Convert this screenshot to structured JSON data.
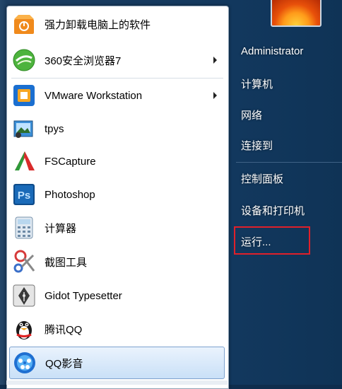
{
  "user": {
    "name": "Administrator"
  },
  "programs": [
    {
      "label": "强力卸载电脑上的软件",
      "icon": "uninstall-box-icon",
      "arrow": false
    },
    {
      "label": "360安全浏览器7",
      "icon": "360-browser-icon",
      "arrow": true
    },
    {
      "label": "VMware Workstation",
      "icon": "vmware-icon",
      "arrow": true
    },
    {
      "label": "tpys",
      "icon": "image-compress-icon",
      "arrow": false
    },
    {
      "label": "FSCapture",
      "icon": "fscapture-icon",
      "arrow": false
    },
    {
      "label": "Photoshop",
      "icon": "photoshop-icon",
      "arrow": false
    },
    {
      "label": "计算器",
      "icon": "calculator-icon",
      "arrow": false
    },
    {
      "label": "截图工具",
      "icon": "snipping-tool-icon",
      "arrow": false
    },
    {
      "label": "Gidot Typesetter",
      "icon": "fountain-pen-icon",
      "arrow": false
    },
    {
      "label": "腾讯QQ",
      "icon": "qq-penguin-icon",
      "arrow": false
    },
    {
      "label": "QQ影音",
      "icon": "qq-player-icon",
      "arrow": false,
      "selected": true
    }
  ],
  "right_items": [
    {
      "label": "Administrator"
    },
    {
      "label": "计算机"
    },
    {
      "label": "网络"
    },
    {
      "label": "连接到"
    },
    {
      "label": "控制面板"
    },
    {
      "label": "设备和打印机"
    },
    {
      "label": "运行..."
    }
  ],
  "colors": {
    "highlight_box": "#e0202a",
    "pane_background": "#12385e"
  }
}
